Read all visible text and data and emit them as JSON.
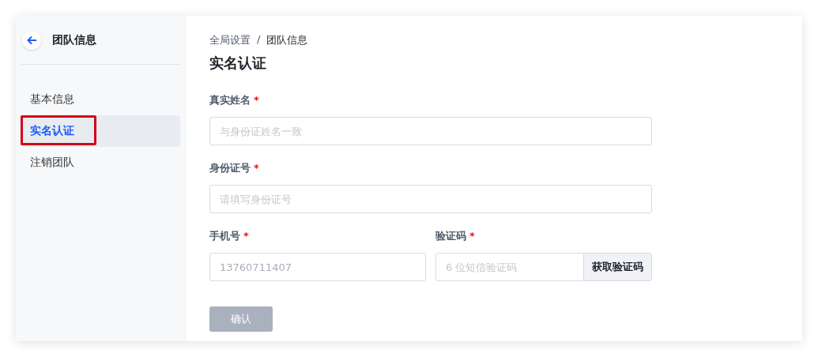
{
  "sidebar": {
    "title": "团队信息",
    "items": [
      {
        "label": "基本信息",
        "selected": false,
        "highlighted": false
      },
      {
        "label": "实名认证",
        "selected": true,
        "highlighted": true
      },
      {
        "label": "注销团队",
        "selected": false,
        "highlighted": false
      }
    ]
  },
  "breadcrumb": [
    "全局设置",
    "团队信息"
  ],
  "breadcrumb_separator": "/",
  "heading": "实名认证",
  "fields": [
    {
      "label": "真实姓名",
      "required_mark": "*",
      "placeholder": "与身份证姓名一致"
    },
    {
      "label": "身份证号",
      "required_mark": "*",
      "placeholder": "请填写身份证号"
    }
  ],
  "row_fields": [
    {
      "label": "手机号",
      "required_mark": "*",
      "value": "13760711407",
      "disabled": true
    },
    {
      "label": "验证码",
      "required_mark": "*",
      "placeholder": "6 位短信验证码",
      "button": "获取验证码"
    }
  ],
  "submit": {
    "label": "确认",
    "disabled": true
  }
}
